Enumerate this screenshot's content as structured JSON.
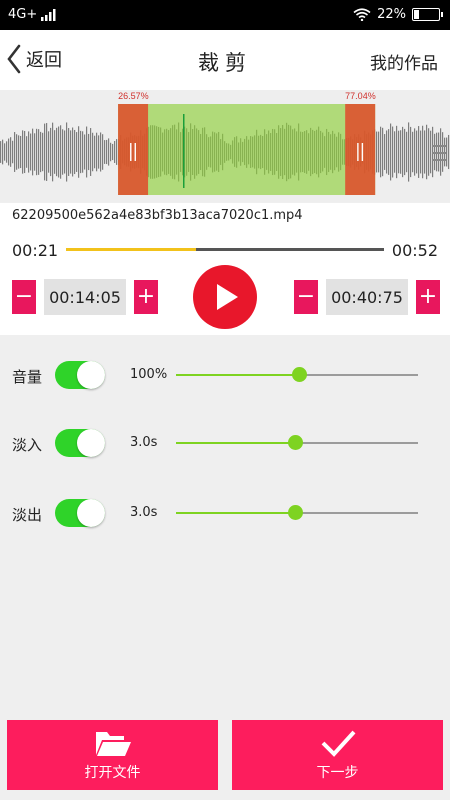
{
  "status": {
    "network": "4G+",
    "battery": "22%",
    "battery_level": 0.22
  },
  "header": {
    "back_label": "返回",
    "title": "裁剪",
    "works_label": "我的作品"
  },
  "waveform": {
    "left_percent": "26.57%",
    "right_percent": "77.04%",
    "selection": [
      0.2657,
      0.7704
    ]
  },
  "file": {
    "name": "62209500e562a4e83bf3b13aca7020c1.mp4"
  },
  "timeline": {
    "start": "00:21",
    "end": "00:52",
    "progress": 0.41
  },
  "start_stepper": {
    "minus": "−",
    "value": "00:14:05",
    "plus": "+"
  },
  "end_stepper": {
    "minus": "−",
    "value": "00:40:75",
    "plus": "+"
  },
  "controls": [
    {
      "label": "音量",
      "value": "100%",
      "level": 0.51
    },
    {
      "label": "淡入",
      "value": "3.0s",
      "level": 0.49
    },
    {
      "label": "淡出",
      "value": "3.0s",
      "level": 0.49
    }
  ],
  "bottom": {
    "open_label": "打开文件",
    "next_label": "下一步"
  },
  "colors": {
    "accent": "#fd1d5d",
    "play": "#e8172b",
    "toggle": "#2fd329",
    "slider": "#7ed321",
    "progress": "#f2c21b"
  }
}
